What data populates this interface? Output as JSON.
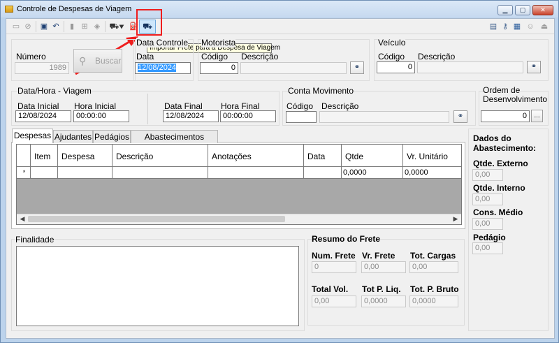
{
  "window": {
    "title": "Controle de Despesas de Viagem",
    "minimize_glyph": "▁",
    "maximize_glyph": "▢",
    "close_glyph": "✕"
  },
  "toolbar": {
    "tooltip": "Importar Frete para a Despesa de Viagem",
    "icons": [
      "new-icon",
      "cancel-icon",
      "save-icon",
      "undo-icon",
      "delete-icon",
      "print-icon",
      "copy-icon",
      "car-dropdown-icon",
      "fuel-pump-icon",
      "truck-icon",
      "window-icon",
      "key-icon",
      "calculator-icon",
      "user-icon",
      "exit-icon"
    ]
  },
  "header": {
    "numero_label": "Número",
    "numero_value": "1989",
    "buscar_label": "Buscar",
    "data_controle_label": "Data Controle",
    "data_label": "Data",
    "data_value": "12/08/2024",
    "motorista_label": "Motorista",
    "motorista_codigo_label": "Código",
    "motorista_codigo_value": "0",
    "motorista_descricao_label": "Descrição",
    "motorista_descricao_value": "",
    "veiculo_label": "Veículo",
    "veiculo_codigo_label": "Código",
    "veiculo_codigo_value": "0",
    "veiculo_descricao_label": "Descrição",
    "veiculo_descricao_value": ""
  },
  "viagem": {
    "group_label": "Data/Hora - Viagem",
    "data_inicial_label": "Data Inicial",
    "data_inicial_value": "12/08/2024",
    "hora_inicial_label": "Hora Inicial",
    "hora_inicial_value": "00:00:00",
    "data_final_label": "Data Final",
    "data_final_value": "12/08/2024",
    "hora_final_label": "Hora Final",
    "hora_final_value": "00:00:00"
  },
  "conta": {
    "group_label": "Conta Movimento",
    "codigo_label": "Código",
    "codigo_value": "",
    "descricao_label": "Descrição",
    "descricao_value": ""
  },
  "ordem": {
    "label_line1": "Ordem de",
    "label_line2": "Desenvolvimento",
    "value": "0",
    "ellipsis": "..."
  },
  "tabs": [
    "Despesas",
    "Ajudantes",
    "Pedágios",
    "Abastecimentos Avulsos"
  ],
  "grid": {
    "columns": [
      "Item",
      "Despesa",
      "Descrição",
      "Anotações",
      "Data",
      "Qtde",
      "Vr. Unitário"
    ],
    "new_row_marker": "*",
    "row": [
      "",
      "",
      "",
      "",
      "",
      "0,0000",
      "0,0000"
    ]
  },
  "abastecimento": {
    "title_line1": "Dados do",
    "title_line2": "Abastecimento:",
    "externo_label": "Qtde. Externo",
    "externo_value": "0,00",
    "interno_label": "Qtde. Interno",
    "interno_value": "0,00",
    "consumo_label": "Cons. Médio",
    "consumo_value": "0,00",
    "pedagio_label": "Pedágio",
    "pedagio_value": "0,00"
  },
  "finalidade": {
    "label": "Finalidade",
    "value": ""
  },
  "resumo": {
    "title": "Resumo do Frete",
    "num_frete_label": "Num. Frete",
    "num_frete_value": "0",
    "vr_frete_label": "Vr. Frete",
    "vr_frete_value": "0,00",
    "tot_cargas_label": "Tot. Cargas",
    "tot_cargas_value": "0,00",
    "total_vol_label": "Total Vol.",
    "total_vol_value": "0,00",
    "tot_p_liq_label": "Tot P. Liq.",
    "tot_p_liq_value": "0,0000",
    "tot_p_bruto_label": "Tot. P. Bruto",
    "tot_p_bruto_value": "0,0000"
  },
  "colors": {
    "accent_red": "#ef1e1e",
    "selection_blue": "#3399ff"
  }
}
